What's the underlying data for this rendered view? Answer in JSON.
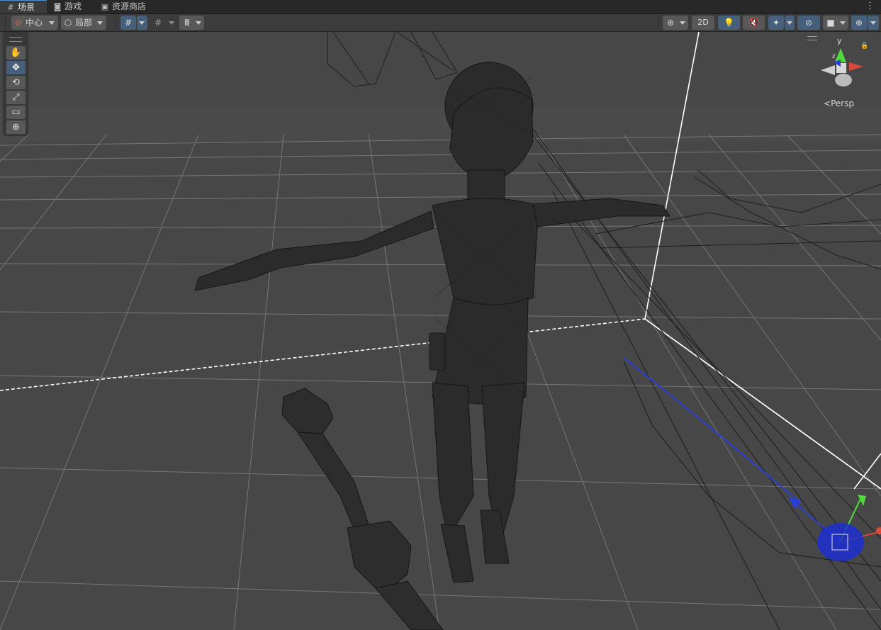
{
  "tabs": [
    {
      "label": "场景",
      "icon": "grid-icon",
      "active": true
    },
    {
      "label": "游戏",
      "icon": "gamepad-icon",
      "active": false
    },
    {
      "label": "资源商店",
      "icon": "bag-icon",
      "active": false
    }
  ],
  "tab_menu_glyph": "⋮",
  "toolbar": {
    "pivot_label": "中心",
    "space_label": "局部",
    "mode_2d_label": "2D"
  },
  "view": {
    "projection_label": "Persp",
    "gizmo_axis_label": "y",
    "gizmo_axis_z_label": "z"
  },
  "colors": {
    "selected": "#46607c",
    "axis_x": "#d94a3a",
    "axis_y": "#4fdc3a",
    "axis_z": "#2a3fd6",
    "background": "#474747"
  }
}
